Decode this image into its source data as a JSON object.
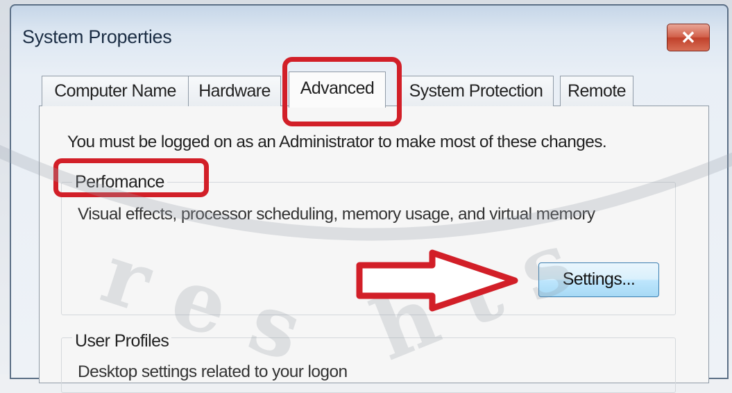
{
  "window": {
    "title": "System Properties",
    "close_glyph": "✕"
  },
  "tabs": [
    {
      "label": "Computer Name",
      "active": false
    },
    {
      "label": "Hardware",
      "active": false
    },
    {
      "label": "Advanced",
      "active": true
    },
    {
      "label": "System Protection",
      "active": false
    },
    {
      "label": "Remote",
      "active": false
    }
  ],
  "advanced": {
    "notice": "You must be logged on as an Administrator to make most of these changes.",
    "performance": {
      "label": "Perfomance",
      "description": "Visual effects, processor scheduling, memory usage, and virtual memory",
      "settings_button": "Settings..."
    },
    "user_profiles": {
      "label": "User Profiles",
      "description": "Desktop settings related to your logon"
    }
  },
  "annotations": {
    "highlight_color": "#d21f28",
    "arrow_icon": "right-arrow-icon"
  }
}
